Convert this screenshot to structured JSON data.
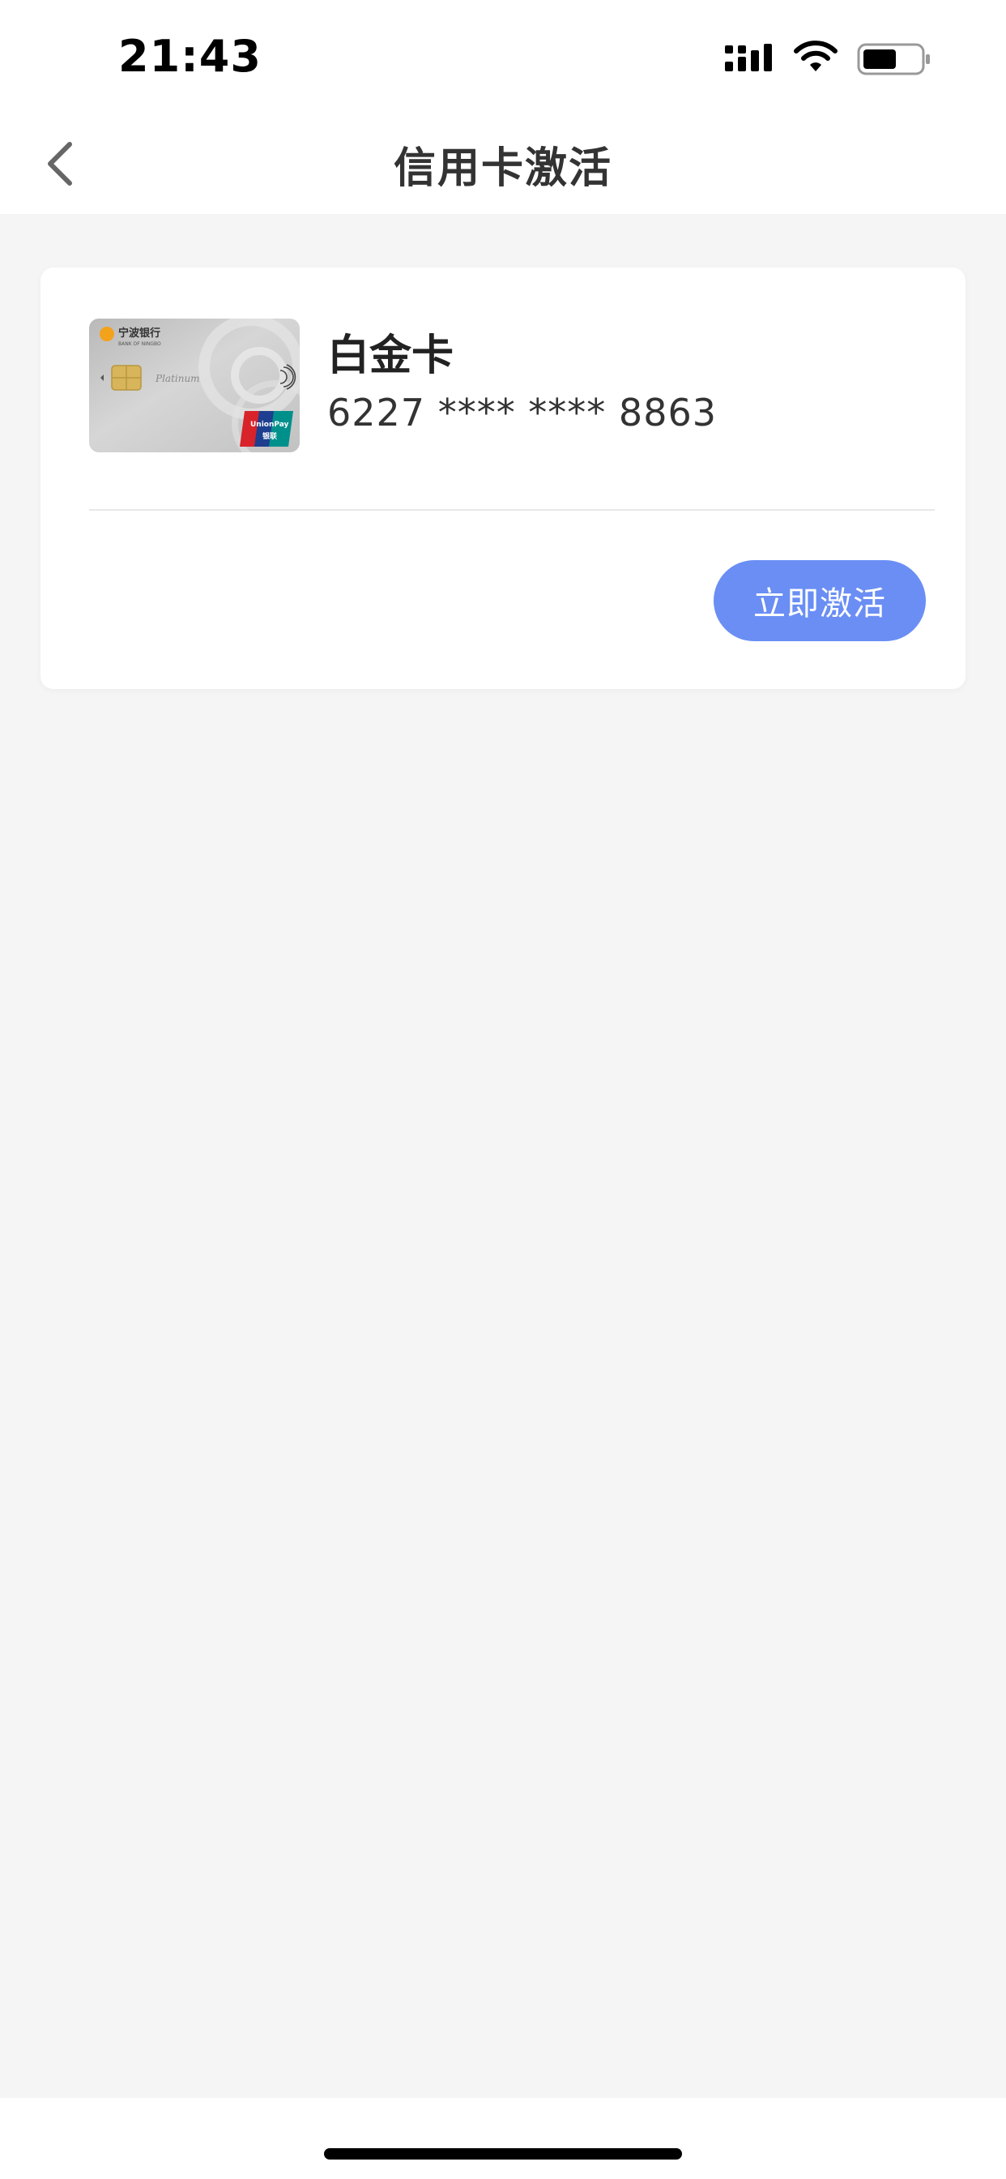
{
  "status_bar": {
    "time": "21:43",
    "icons": [
      "signal-icon",
      "wifi-icon",
      "battery-icon"
    ]
  },
  "nav": {
    "title": "信用卡激活",
    "back_icon": "chevron-left-icon"
  },
  "card": {
    "name": "白金卡",
    "number": "6227 **** **** 8863",
    "image": {
      "bank_name_cn": "宁波银行",
      "bank_name_en": "BANK OF NINGBO",
      "tier_label": "Platinum",
      "network_label": "UnionPay",
      "network_label_cn": "银联"
    },
    "activate_label": "立即激活"
  },
  "colors": {
    "accent": "#6a8ef4",
    "page_background": "#f5f5f5",
    "panel_background": "#ffffff",
    "title_text": "#333333"
  }
}
